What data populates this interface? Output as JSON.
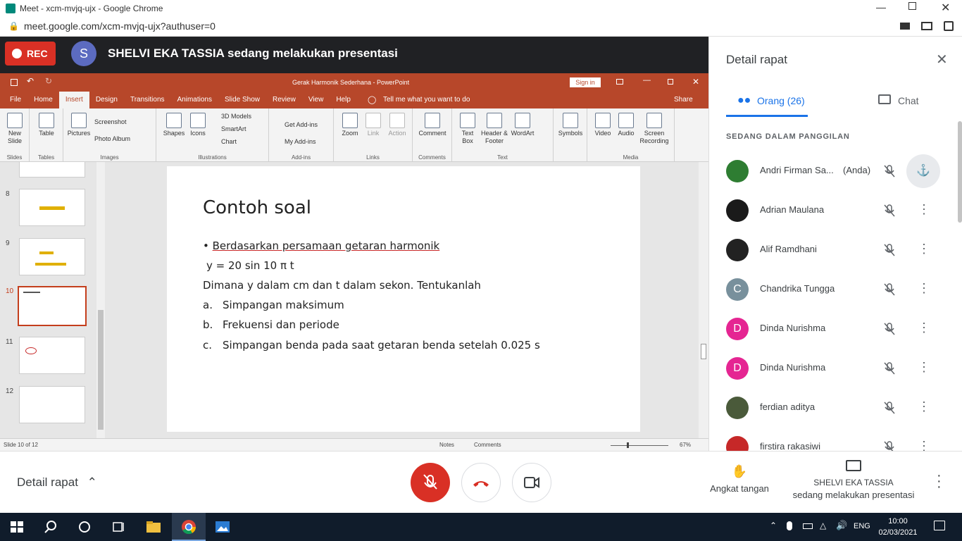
{
  "browser": {
    "window_title": "Meet - xcm-mvjq-ujx - Google Chrome",
    "url": "meet.google.com/xcm-mvjq-ujx?authuser=0"
  },
  "meet": {
    "rec_label": "REC",
    "presenter_initial": "S",
    "presenting_banner": "SHELVI EKA TASSIA sedang melakukan presentasi"
  },
  "ppt": {
    "title": "Gerak Harmonik Sederhana  -  PowerPoint",
    "sign_in": "Sign in",
    "share": "Share",
    "tell_me": "Tell me what you want to do",
    "tabs": [
      "File",
      "Home",
      "Insert",
      "Design",
      "Transitions",
      "Animations",
      "Slide Show",
      "Review",
      "View",
      "Help"
    ],
    "active_tab": "Insert",
    "groups": [
      "Slides",
      "Tables",
      "Images",
      "Illustrations",
      "Add-ins",
      "Links",
      "Comments",
      "Text",
      "Media"
    ],
    "buttons": {
      "new_slide": "New Slide",
      "table": "Table",
      "pictures": "Pictures",
      "screenshot": "Screenshot",
      "photo_album": "Photo Album",
      "shapes": "Shapes",
      "icons": "Icons",
      "models": "3D Models",
      "smartart": "SmartArt",
      "chart": "Chart",
      "get_addins": "Get Add-ins",
      "my_addins": "My Add-ins",
      "zoom": "Zoom",
      "link": "Link",
      "action": "Action",
      "comment": "Comment",
      "textbox": "Text Box",
      "header_footer": "Header & Footer",
      "wordart": "WordArt",
      "symbols": "Symbols",
      "video": "Video",
      "audio": "Audio",
      "screen_recording": "Screen Recording"
    },
    "slide_numbers": [
      "8",
      "9",
      "10",
      "11",
      "12"
    ],
    "current_slide": "10",
    "slide": {
      "title": "Contoh soal",
      "bullet": "Berdasarkan persamaan getaran harmonik",
      "equation": "y = 20 sin 10 π t",
      "line3": "Dimana y dalam cm dan t dalam sekon. Tentukanlah",
      "items": [
        {
          "marker": "a.",
          "text": "Simpangan maksimum"
        },
        {
          "marker": "b.",
          "text": "Frekuensi dan periode"
        },
        {
          "marker": "c.",
          "text": "Simpangan benda pada saat getaran benda setelah 0.025 s"
        }
      ]
    },
    "status": {
      "slide_of": "Slide 10 of 12",
      "notes": "Notes",
      "comments": "Comments",
      "zoom": "67%"
    }
  },
  "sidepanel": {
    "title": "Detail rapat",
    "tab_people": "Orang (26)",
    "tab_chat": "Chat",
    "section": "SEDANG DALAM PANGGILAN",
    "people": [
      {
        "name": "Andri Firman Sa...",
        "suffix": "(Anda)",
        "initial": "",
        "color": "#2e7d32"
      },
      {
        "name": "Adrian Maulana",
        "initial": "",
        "color": "#1a1a1a"
      },
      {
        "name": "Alif Ramdhani",
        "initial": "",
        "color": "#222222"
      },
      {
        "name": "Chandrika Tungga",
        "initial": "C",
        "color": "#78909c"
      },
      {
        "name": "Dinda Nurishma",
        "initial": "D",
        "color": "#e52592"
      },
      {
        "name": "Dinda Nurishma",
        "initial": "D",
        "color": "#e52592"
      },
      {
        "name": "ferdian aditya",
        "initial": "",
        "color": "#4a5a3a"
      },
      {
        "name": "firstira rakasiwi",
        "initial": "",
        "color": "#c62828"
      }
    ]
  },
  "bottombar": {
    "details": "Detail rapat",
    "raise_hand": "Angkat tangan",
    "presenting_name": "SHELVI EKA TASSIA",
    "presenting_sub": "sedang melakukan presentasi"
  },
  "taskbar": {
    "lang": "ENG",
    "time": "10:00",
    "date": "02/03/2021"
  }
}
